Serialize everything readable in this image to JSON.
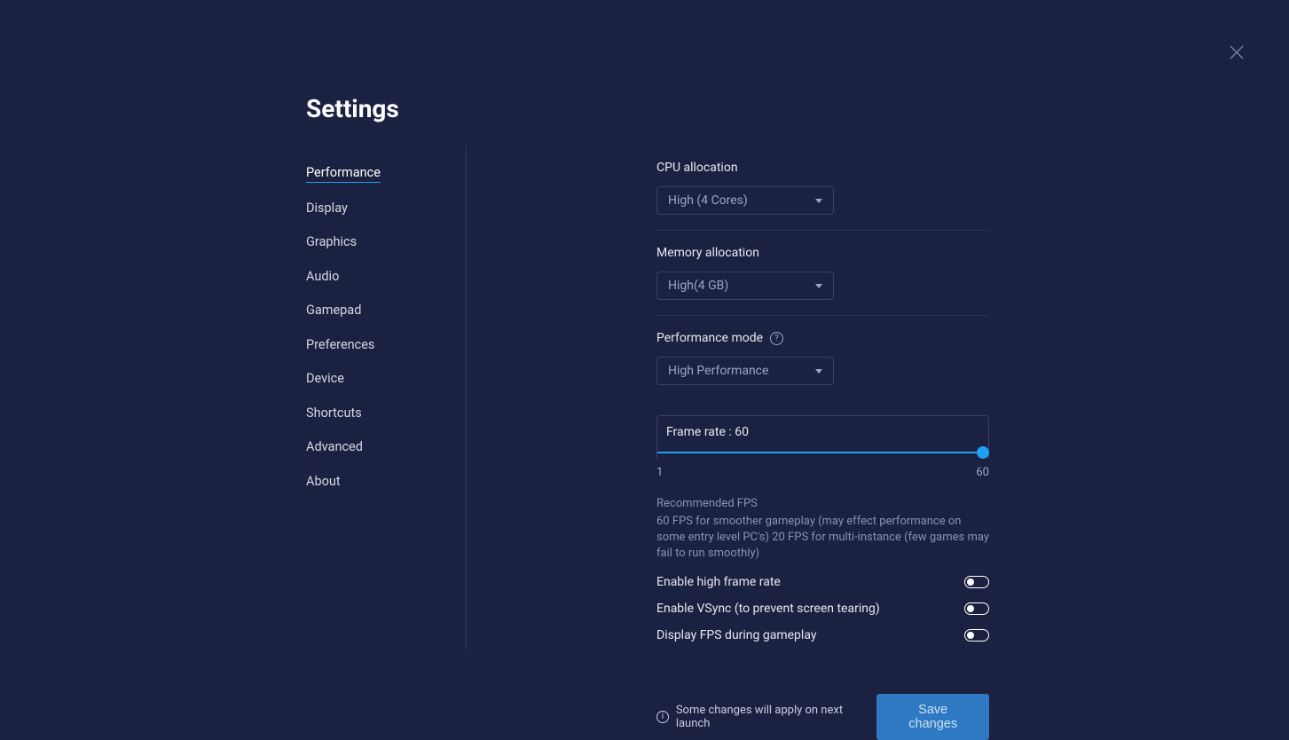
{
  "title": "Settings",
  "sidebar": {
    "items": [
      {
        "label": "Performance",
        "active": true
      },
      {
        "label": "Display"
      },
      {
        "label": "Graphics"
      },
      {
        "label": "Audio"
      },
      {
        "label": "Gamepad"
      },
      {
        "label": "Preferences"
      },
      {
        "label": "Device"
      },
      {
        "label": "Shortcuts"
      },
      {
        "label": "Advanced"
      },
      {
        "label": "About"
      }
    ]
  },
  "cpu": {
    "label": "CPU allocation",
    "value": "High (4 Cores)"
  },
  "memory": {
    "label": "Memory allocation",
    "value": "High(4 GB)"
  },
  "perfmode": {
    "label": "Performance mode",
    "value": "High Performance"
  },
  "framerate": {
    "label": "Frame rate : 60",
    "min": "1",
    "max": "60",
    "value": 60
  },
  "recommended": {
    "title": "Recommended FPS",
    "body": "60 FPS for smoother gameplay (may effect performance on some entry level PC's) 20 FPS for multi-instance (few games may fail to run smoothly)"
  },
  "toggles": {
    "high_fps": {
      "label": "Enable high frame rate",
      "on": false
    },
    "vsync": {
      "label": "Enable VSync (to prevent screen tearing)",
      "on": false
    },
    "display_fps": {
      "label": "Display FPS during gameplay",
      "on": false
    }
  },
  "footer": {
    "note": "Some changes will apply on next launch",
    "save": "Save changes"
  }
}
